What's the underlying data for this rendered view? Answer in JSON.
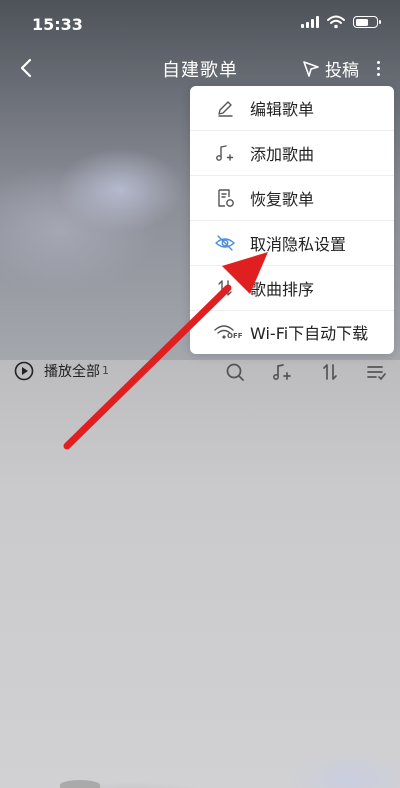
{
  "status_bar": {
    "time": "15:33"
  },
  "nav": {
    "title": "自建歌单",
    "contribute_label": "投稿"
  },
  "toolbar": {
    "play_all_label": "播放全部",
    "play_count": "1"
  },
  "menu": {
    "items": [
      {
        "label": "编辑歌单",
        "icon": "pencil-icon"
      },
      {
        "label": "添加歌曲",
        "icon": "music-add-icon"
      },
      {
        "label": "恢复歌单",
        "icon": "restore-doc-icon"
      },
      {
        "label": "取消隐私设置",
        "icon": "eye-hidden-icon"
      },
      {
        "label": "歌曲排序",
        "icon": "sort-icon"
      },
      {
        "label": "Wi-Fi下自动下载",
        "icon": "wifi-off-icon",
        "icon_text": "OFF"
      }
    ]
  },
  "colors": {
    "accent_blue": "#4a8fe0",
    "arrow_red": "#e02020",
    "menu_bg": "#ffffff"
  }
}
